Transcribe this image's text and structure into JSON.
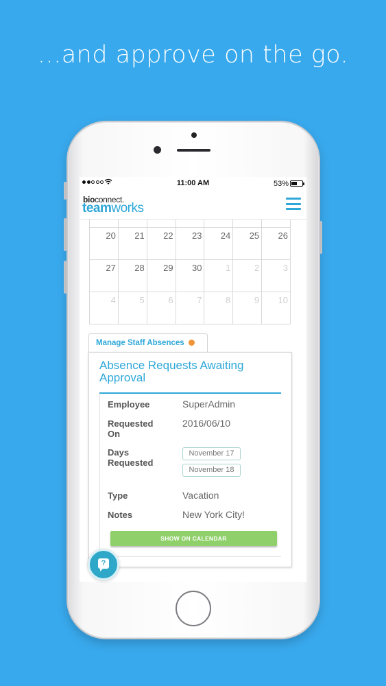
{
  "headline": "...and approve on the go.",
  "statusbar": {
    "time": "11:00 AM",
    "battery": "53%"
  },
  "logo": {
    "top_bold": "bio",
    "top_rest": "connect.",
    "bottom_bold": "team",
    "bottom_rest": "works"
  },
  "calendar": {
    "rows": [
      [
        {
          "d": "20"
        },
        {
          "d": "21"
        },
        {
          "d": "22"
        },
        {
          "d": "23"
        },
        {
          "d": "24"
        },
        {
          "d": "25"
        },
        {
          "d": "26"
        }
      ],
      [
        {
          "d": "27"
        },
        {
          "d": "28"
        },
        {
          "d": "29"
        },
        {
          "d": "30"
        },
        {
          "d": "1",
          "muted": true
        },
        {
          "d": "2",
          "muted": true
        },
        {
          "d": "3",
          "muted": true
        }
      ],
      [
        {
          "d": "4",
          "muted": true
        },
        {
          "d": "5",
          "muted": true
        },
        {
          "d": "6",
          "muted": true
        },
        {
          "d": "7",
          "muted": true
        },
        {
          "d": "8",
          "muted": true
        },
        {
          "d": "9",
          "muted": true
        },
        {
          "d": "10",
          "muted": true
        }
      ]
    ]
  },
  "tab": {
    "label": "Manage Staff Absences"
  },
  "panel": {
    "title": "Absence Requests Awaiting Approval",
    "employee_label": "Employee",
    "employee": "SuperAdmin",
    "requested_label": "Requested On",
    "requested": "2016/06/10",
    "days_label": "Days Requested",
    "days": [
      "November 17",
      "November 18"
    ],
    "type_label": "Type",
    "type": "Vacation",
    "notes_label": "Notes",
    "notes": "New York City!",
    "button": "SHOW ON CALENDAR"
  },
  "help": {
    "glyph": "?"
  },
  "colors": {
    "background": "#39a9ed",
    "accent": "#2ea7d8",
    "notice": "#f0943a",
    "button": "#8fd06a"
  }
}
